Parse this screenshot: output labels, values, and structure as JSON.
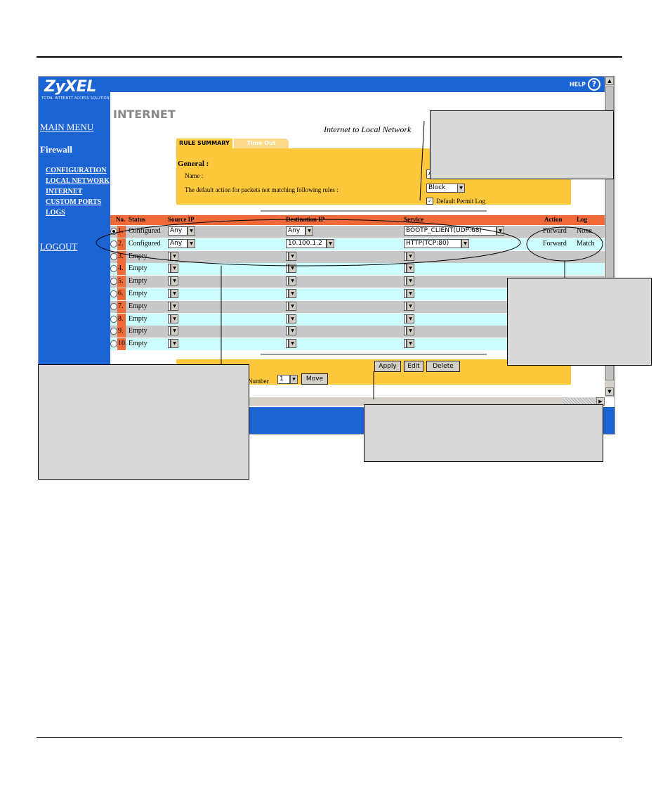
{
  "brand": {
    "logo": "ZyXEL",
    "tagline": "TOTAL INTERNET ACCESS SOLUTION",
    "help": "HELP"
  },
  "sidebar": {
    "main_menu": "MAIN MENU",
    "section": "Firewall",
    "items": [
      "CONFIGURATION",
      "LOCAL NETWORK",
      "INTERNET",
      "CUSTOM PORTS",
      "LOGS"
    ],
    "logout": "LOGOUT"
  },
  "page": {
    "title": "INTERNET",
    "direction": "Internet to Local Network",
    "tabs": [
      "RULE SUMMARY",
      "Time Out"
    ]
  },
  "general": {
    "heading": "General :",
    "name_label": "Name :",
    "name_value": "A",
    "default_action_label": "The default action for packets not matching following rules :",
    "default_action_value": "Block",
    "permit_log_label": "Default Permit Log"
  },
  "table": {
    "headers": [
      "No.",
      "Status",
      "Source IP",
      "Destination IP",
      "Service",
      "Action",
      "Log"
    ],
    "rows": [
      {
        "no": "1.",
        "status": "Configured",
        "source": "Any",
        "dest": "Any",
        "service": "BOOTP_CLIENT(UDP:68)",
        "action": "Forward",
        "log": "None"
      },
      {
        "no": "2.",
        "status": "Configured",
        "source": "Any",
        "dest": "10.100.1.2",
        "service": "HTTP(TCP:80)",
        "action": "Forward",
        "log": "Match"
      },
      {
        "no": "3.",
        "status": "Empty",
        "source": "",
        "dest": "",
        "service": "",
        "action": "",
        "log": ""
      },
      {
        "no": "4.",
        "status": "Empty",
        "source": "",
        "dest": "",
        "service": "",
        "action": "",
        "log": ""
      },
      {
        "no": "5.",
        "status": "Empty",
        "source": "",
        "dest": "",
        "service": "",
        "action": "",
        "log": ""
      },
      {
        "no": "6.",
        "status": "Empty",
        "source": "",
        "dest": "",
        "service": "",
        "action": "",
        "log": ""
      },
      {
        "no": "7.",
        "status": "Empty",
        "source": "",
        "dest": "",
        "service": "",
        "action": "",
        "log": ""
      },
      {
        "no": "8.",
        "status": "Empty",
        "source": "",
        "dest": "",
        "service": "",
        "action": "",
        "log": ""
      },
      {
        "no": "9.",
        "status": "Empty",
        "source": "",
        "dest": "",
        "service": "",
        "action": "",
        "log": ""
      },
      {
        "no": "10.",
        "status": "Empty",
        "source": "",
        "dest": "",
        "service": "",
        "action": "",
        "log": ""
      }
    ]
  },
  "actions": {
    "apply": "Apply",
    "edit": "Edit",
    "delete": "Delete",
    "move_label": "Number",
    "move_value": "1",
    "move": "Move"
  },
  "colors": {
    "sidebar": "#1c63d4",
    "panel": "#fdc83c",
    "header_row": "#f06a3a",
    "row_odd": "#c8c8c8",
    "row_even": "#cdfcfc"
  }
}
